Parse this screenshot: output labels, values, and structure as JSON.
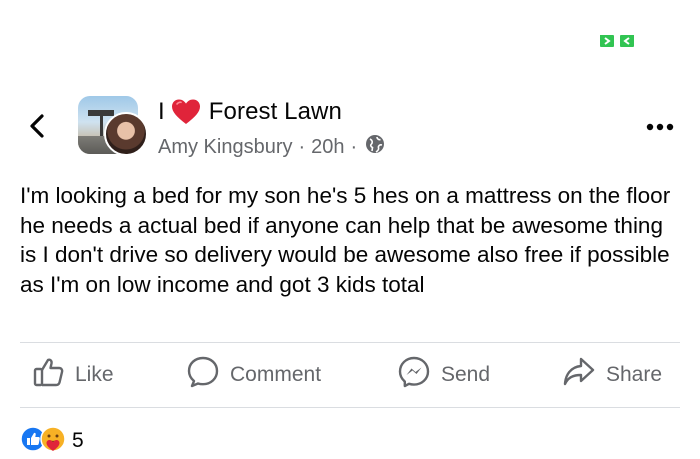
{
  "status_bar": {
    "expand_icon": "expand-arrows-icon",
    "accent": "#31c452"
  },
  "header": {
    "back_icon": "chevron-left-icon",
    "group_name_prefix": "I",
    "group_name_icon": "red-heart-icon",
    "group_name_suffix": "Forest Lawn",
    "author": "Amy Kingsbury",
    "separator": "·",
    "time": "20h",
    "audience_icon": "globe-icon",
    "more_icon": "more-dots-icon"
  },
  "post": {
    "text": "I'm looking a bed for my son he's 5 hes on a mattress on the floor he needs a actual bed if anyone can help that be awesome thing is I don't drive so delivery would be awesome also free if possible as I'm on low income and got 3 kids total"
  },
  "actions": [
    {
      "label": "Like",
      "icon": "thumbs-up-icon"
    },
    {
      "label": "Comment",
      "icon": "comment-bubble-icon"
    },
    {
      "label": "Send",
      "icon": "messenger-icon"
    },
    {
      "label": "Share",
      "icon": "share-arrow-icon"
    }
  ],
  "reactions": {
    "icons": [
      "like-reaction-icon",
      "care-reaction-icon"
    ],
    "count": "5"
  },
  "colors": {
    "text": "#050505",
    "secondary_text": "#65676b",
    "divider": "#dadde1",
    "like_blue": "#1877f2",
    "heart_red": "#e0243a"
  }
}
